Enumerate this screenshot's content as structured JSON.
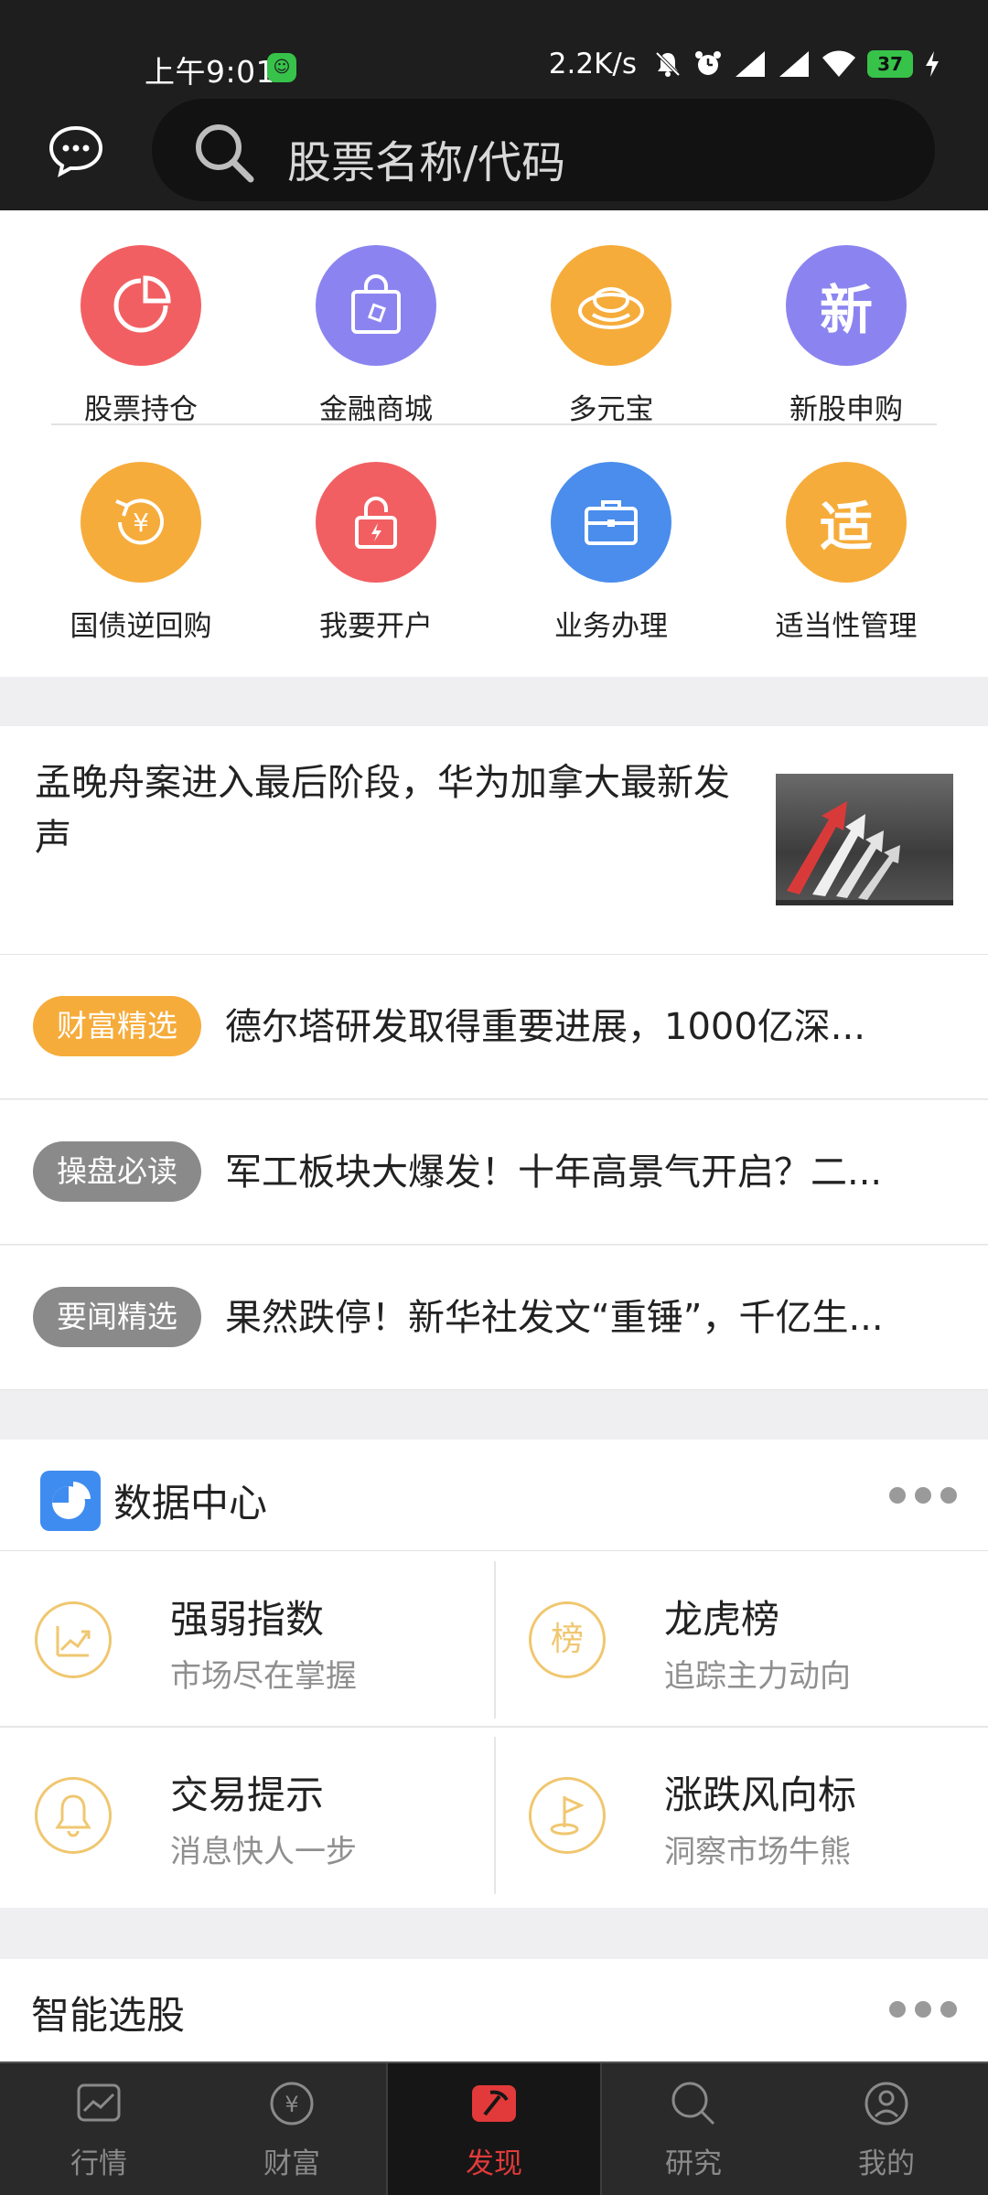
{
  "status_bar": {
    "time": "上午9:01",
    "speed": "2.2K/s",
    "battery": "37"
  },
  "search": {
    "placeholder": "股票名称/代码"
  },
  "quick_grid": [
    {
      "label": "股票持仓",
      "color": "#f25f62",
      "glyph": ""
    },
    {
      "label": "金融商城",
      "color": "#8b84f0",
      "glyph": ""
    },
    {
      "label": "多元宝",
      "color": "#f6ac3b",
      "glyph": ""
    },
    {
      "label": "新股申购",
      "color": "#8b84f0",
      "glyph": "新"
    },
    {
      "label": "国债逆回购",
      "color": "#f6ac3b",
      "glyph": ""
    },
    {
      "label": "我要开户",
      "color": "#f25f62",
      "glyph": ""
    },
    {
      "label": "业务办理",
      "color": "#4a8ded",
      "glyph": ""
    },
    {
      "label": "适当性管理",
      "color": "#f6ac3b",
      "glyph": "适"
    }
  ],
  "news": {
    "headline": "孟晚舟案进入最后阶段，华为加拿大最新发声",
    "items": [
      {
        "tag": "财富精选",
        "tag_color": "#f6ac3b",
        "text": "德尔塔研发取得重要进展，1000亿深..."
      },
      {
        "tag": "操盘必读",
        "tag_color": "#8a8a8a",
        "text": "军工板块大爆发！十年高景气开启？二..."
      },
      {
        "tag": "要闻精选",
        "tag_color": "#8a8a8a",
        "text": "果然跌停！新华社发文“重锤”，千亿生..."
      }
    ]
  },
  "data_center": {
    "title": "数据中心",
    "cells": [
      {
        "name": "强弱指数",
        "sub": "市场尽在掌握",
        "icon": "trend-chart-icon"
      },
      {
        "name": "龙虎榜",
        "sub": "追踪主力动向",
        "icon": "bang-icon",
        "glyph": "榜"
      },
      {
        "name": "交易提示",
        "sub": "消息快人一步",
        "icon": "bell-icon"
      },
      {
        "name": "涨跌风向标",
        "sub": "洞察市场牛熊",
        "icon": "flag-icon"
      }
    ]
  },
  "smart_pick": {
    "title": "智能选股"
  },
  "bottom_nav": [
    {
      "label": "行情",
      "active": false
    },
    {
      "label": "财富",
      "active": false
    },
    {
      "label": "发现",
      "active": true
    },
    {
      "label": "研究",
      "active": false
    },
    {
      "label": "我的",
      "active": false
    }
  ],
  "colors": {
    "accent_red": "#e23a3a",
    "header_bg": "#1e1e1e"
  }
}
